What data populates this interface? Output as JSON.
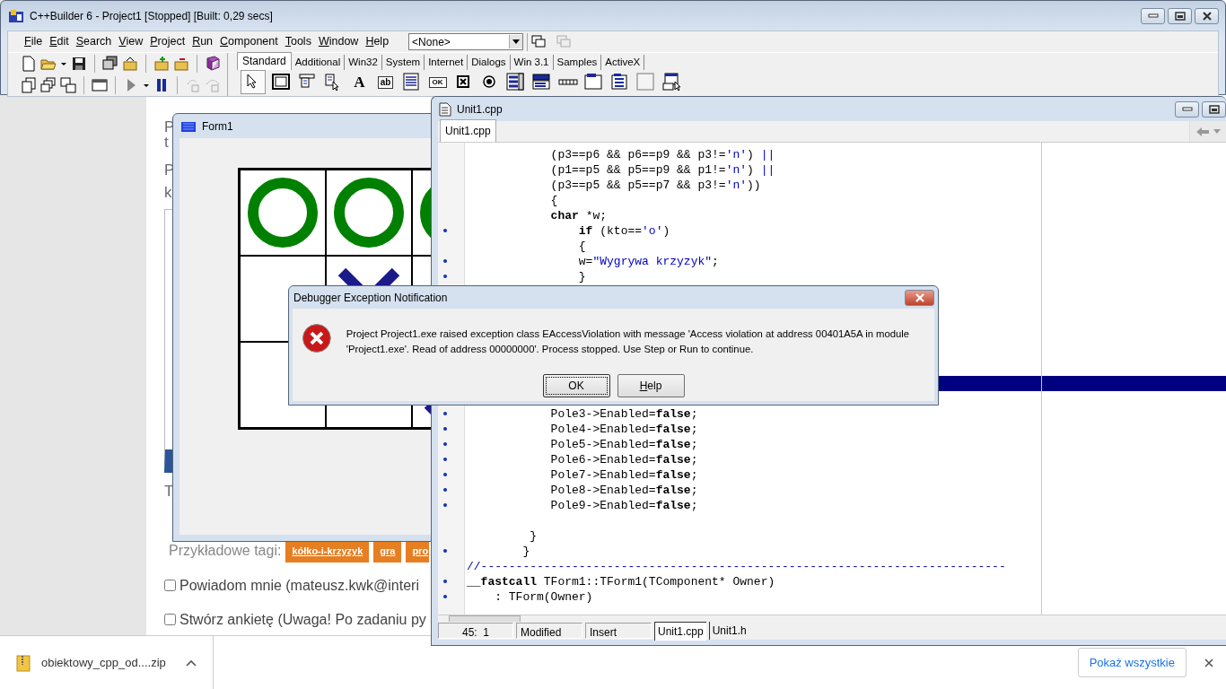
{
  "webpage": {
    "fragments": [
      "P",
      "t",
      "P",
      "k",
      "T"
    ],
    "tags_label": "Przykładowe tagi:",
    "tags": [
      "kółko-i-krzyzyk",
      "gra",
      "pro"
    ],
    "options": [
      {
        "label": "Powiadom mnie (mateusz.kwk@interi",
        "checked": false
      },
      {
        "label": "Stwórz ankietę (Uwaga! Po zadaniu py",
        "checked": false
      }
    ]
  },
  "ide": {
    "title": "C++Builder 6 - Project1 [Stopped] [Built: 0,29 secs]",
    "menu": [
      "File",
      "Edit",
      "Search",
      "View",
      "Project",
      "Run",
      "Component",
      "Tools",
      "Window",
      "Help"
    ],
    "target_combo": {
      "value": "<None>"
    },
    "palette_tabs": [
      {
        "label": "Standard",
        "selected": true
      },
      {
        "label": "Additional",
        "selected": false
      },
      {
        "label": "Win32",
        "selected": false
      },
      {
        "label": "System",
        "selected": false
      },
      {
        "label": "Internet",
        "selected": false
      },
      {
        "label": "Dialogs",
        "selected": false
      },
      {
        "label": "Win 3.1",
        "selected": false
      },
      {
        "label": "Samples",
        "selected": false
      },
      {
        "label": "ActiveX",
        "selected": false
      }
    ],
    "palette_components": [
      {
        "kind": "pointer"
      },
      {
        "kind": "frame"
      },
      {
        "kind": "mainmenu"
      },
      {
        "kind": "popupmenu"
      },
      {
        "kind": "label",
        "glyph": "A"
      },
      {
        "kind": "edit",
        "glyph": "ab"
      },
      {
        "kind": "memo"
      },
      {
        "kind": "button",
        "glyph": "OK"
      },
      {
        "kind": "checkbox"
      },
      {
        "kind": "radio"
      },
      {
        "kind": "listbox"
      },
      {
        "kind": "combobox"
      },
      {
        "kind": "scrollbar"
      },
      {
        "kind": "groupbox"
      },
      {
        "kind": "radiogroup"
      },
      {
        "kind": "panel"
      },
      {
        "kind": "actionlist"
      }
    ]
  },
  "form1": {
    "title": "Form1",
    "board": [
      {
        "kind": "circle"
      },
      {
        "kind": "circle"
      },
      {
        "kind": "circle"
      },
      {
        "kind": "empty"
      },
      {
        "kind": "cross"
      },
      {
        "kind": "empty"
      },
      {
        "kind": "empty"
      },
      {
        "kind": "empty"
      },
      {
        "kind": "cross"
      }
    ]
  },
  "editor": {
    "title": "Unit1.cpp",
    "tabs": [
      {
        "label": "Unit1.cpp",
        "selected": true
      }
    ],
    "code_top": [
      {
        "marked": false,
        "segments": [
          {
            "kind": "plain",
            "text": "            (p3==p6 && p6==p9 && p3!="
          },
          {
            "kind": "string",
            "text": "'n'"
          },
          {
            "kind": "plain",
            "text": ") "
          },
          {
            "kind": "symbol",
            "text": "||"
          }
        ]
      },
      {
        "marked": false,
        "segments": [
          {
            "kind": "plain",
            "text": "            (p1==p5 && p5==p9 && p1!="
          },
          {
            "kind": "string",
            "text": "'n'"
          },
          {
            "kind": "plain",
            "text": ") "
          },
          {
            "kind": "symbol",
            "text": "||"
          }
        ]
      },
      {
        "marked": false,
        "segments": [
          {
            "kind": "plain",
            "text": "            (p3==p5 && p5==p7 && p3!="
          },
          {
            "kind": "string",
            "text": "'n'"
          },
          {
            "kind": "plain",
            "text": "))"
          }
        ]
      },
      {
        "marked": false,
        "segments": [
          {
            "kind": "plain",
            "text": "            {"
          }
        ]
      },
      {
        "marked": false,
        "segments": [
          {
            "kind": "keyword",
            "text": "            char"
          },
          {
            "kind": "plain",
            "text": " *w;"
          }
        ]
      },
      {
        "marked": true,
        "segments": [
          {
            "kind": "keyword",
            "text": "                if"
          },
          {
            "kind": "plain",
            "text": " (kto=="
          },
          {
            "kind": "string",
            "text": "'o'"
          },
          {
            "kind": "plain",
            "text": ")"
          }
        ]
      },
      {
        "marked": false,
        "segments": [
          {
            "kind": "plain",
            "text": "                {"
          }
        ]
      },
      {
        "marked": true,
        "segments": [
          {
            "kind": "plain",
            "text": "                w="
          },
          {
            "kind": "string",
            "text": "\"Wygrywa krzyzyk\""
          },
          {
            "kind": "plain",
            "text": ";"
          }
        ]
      },
      {
        "marked": true,
        "segments": [
          {
            "kind": "plain",
            "text": "                }"
          }
        ]
      }
    ],
    "code_bottom": [
      {
        "marked": true,
        "segments": [
          {
            "kind": "plain",
            "text": "            Pole3->Enabled="
          },
          {
            "kind": "keyword",
            "text": "false"
          },
          {
            "kind": "plain",
            "text": ";"
          }
        ]
      },
      {
        "marked": true,
        "segments": [
          {
            "kind": "plain",
            "text": "            Pole4->Enabled="
          },
          {
            "kind": "keyword",
            "text": "false"
          },
          {
            "kind": "plain",
            "text": ";"
          }
        ]
      },
      {
        "marked": true,
        "segments": [
          {
            "kind": "plain",
            "text": "            Pole5->Enabled="
          },
          {
            "kind": "keyword",
            "text": "false"
          },
          {
            "kind": "plain",
            "text": ";"
          }
        ]
      },
      {
        "marked": true,
        "segments": [
          {
            "kind": "plain",
            "text": "            Pole6->Enabled="
          },
          {
            "kind": "keyword",
            "text": "false"
          },
          {
            "kind": "plain",
            "text": ";"
          }
        ]
      },
      {
        "marked": true,
        "segments": [
          {
            "kind": "plain",
            "text": "            Pole7->Enabled="
          },
          {
            "kind": "keyword",
            "text": "false"
          },
          {
            "kind": "plain",
            "text": ";"
          }
        ]
      },
      {
        "marked": true,
        "segments": [
          {
            "kind": "plain",
            "text": "            Pole8->Enabled="
          },
          {
            "kind": "keyword",
            "text": "false"
          },
          {
            "kind": "plain",
            "text": ";"
          }
        ]
      },
      {
        "marked": true,
        "segments": [
          {
            "kind": "plain",
            "text": "            Pole9->Enabled="
          },
          {
            "kind": "keyword",
            "text": "false"
          },
          {
            "kind": "plain",
            "text": ";"
          }
        ]
      },
      {
        "marked": false,
        "segments": [
          {
            "kind": "plain",
            "text": "         }"
          }
        ]
      },
      {
        "marked": true,
        "segments": [
          {
            "kind": "plain",
            "text": "        }"
          }
        ]
      },
      {
        "marked": false,
        "segments": [
          {
            "kind": "comment",
            "text": "//---------------------------------------------------------------------------"
          }
        ]
      },
      {
        "marked": true,
        "segments": [
          {
            "kind": "keyword",
            "text": "__fastcall"
          },
          {
            "kind": "plain",
            "text": " TForm1::TForm1(TComponent* Owner)"
          }
        ]
      },
      {
        "marked": true,
        "segments": [
          {
            "kind": "plain",
            "text": "    : TForm(Owner)"
          }
        ]
      }
    ],
    "status": {
      "position": "45:  1",
      "modified": "Modified",
      "mode": "Insert"
    },
    "file_tabs": [
      {
        "label": "Unit1.cpp",
        "selected": true
      },
      {
        "label": "Unit1.h",
        "selected": false
      }
    ]
  },
  "dialog": {
    "title": "Debugger Exception Notification",
    "message": "Project Project1.exe raised exception class EAccessViolation with message 'Access violation at address 00401A5A in module 'Project1.exe'. Read of address 00000000'. Process stopped. Use Step or Run to continue.",
    "buttons": [
      {
        "label": "OK",
        "focused": true,
        "mnemonic": false
      },
      {
        "label": "Help",
        "focused": false,
        "mnemonic": true
      }
    ]
  },
  "downloads": {
    "file": "obiektowy_cpp_od....zip",
    "show_all": "Pokaż wszystkie"
  }
}
